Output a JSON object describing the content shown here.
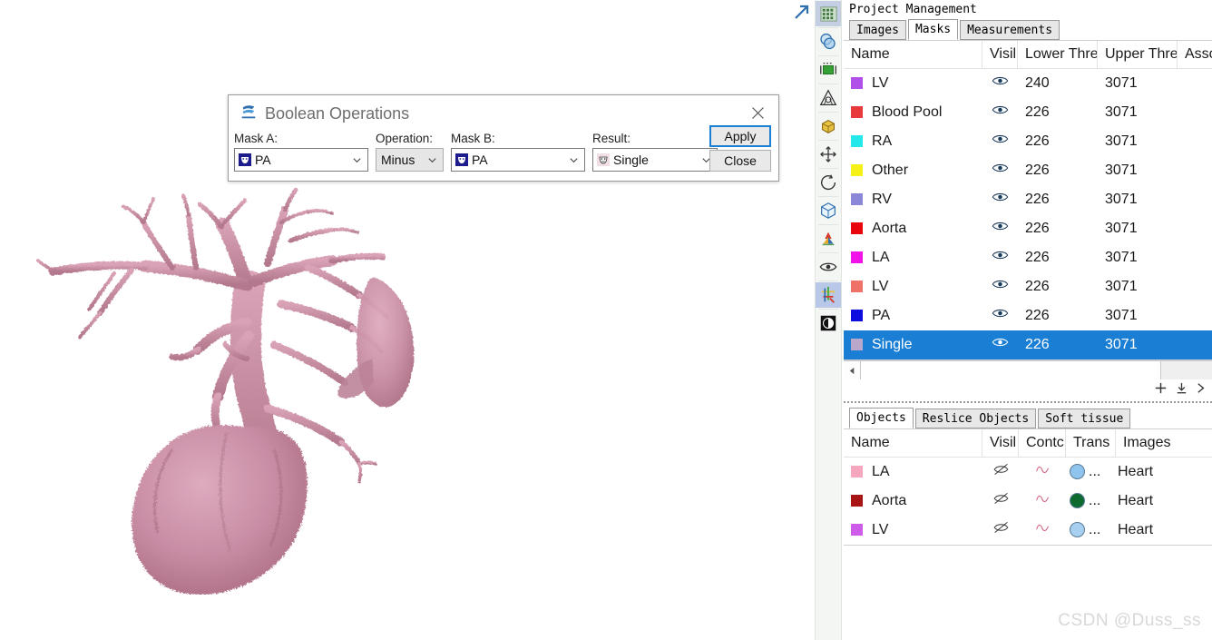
{
  "colors": {
    "accent": "#1a7fd4",
    "panel_bg": "#f4f6f4",
    "heart": "#c78ca2"
  },
  "viewport": {
    "name": "3d-volume-rendering",
    "description": "3D volume rendering of heart and pulmonary vasculature"
  },
  "toolbar": {
    "expand_icon": "expand-arrow-icon",
    "items": [
      {
        "name": "grid-view-icon",
        "label": "Grid View",
        "selected": true
      },
      {
        "name": "boolean-operations-icon",
        "label": "Boolean Operations",
        "selected": false
      },
      {
        "name": "crop-mask-icon",
        "label": "Crop Mask",
        "selected": false
      },
      {
        "name": "region-growing-icon",
        "label": "Region Growing",
        "selected": false
      },
      {
        "name": "calculate-3d-icon",
        "label": "Calculate 3D",
        "selected": false
      },
      {
        "name": "move-icon",
        "label": "Move",
        "selected": false
      },
      {
        "name": "rotate-icon",
        "label": "Rotate",
        "selected": false
      },
      {
        "name": "box-icon",
        "label": "3D Box",
        "selected": false
      },
      {
        "name": "axes-color-icon",
        "label": "Orientation",
        "selected": false
      },
      {
        "name": "eye-icon",
        "label": "Visibility",
        "selected": false
      },
      {
        "name": "axis-cross-icon",
        "label": "Axis Cross",
        "selected": true
      },
      {
        "name": "contrast-icon",
        "label": "Contrast",
        "selected": false
      }
    ]
  },
  "panel": {
    "title": "Project Management",
    "tabs": [
      {
        "label": "Images",
        "active": false
      },
      {
        "label": "Masks",
        "active": true
      },
      {
        "label": "Measurements",
        "active": false
      }
    ],
    "masks_table": {
      "columns": [
        "Name",
        "Visil",
        "Lower Thre",
        "Upper Thre",
        "Asso"
      ],
      "rows": [
        {
          "color": "#b150e8",
          "name": "LV",
          "visible": "eye-icon",
          "lower": "240",
          "upper": "3071",
          "selected": false
        },
        {
          "color": "#e8393c",
          "name": "Blood Pool",
          "visible": "eye-icon",
          "lower": "226",
          "upper": "3071",
          "selected": false
        },
        {
          "color": "#25e8ea",
          "name": "RA",
          "visible": "eye-icon",
          "lower": "226",
          "upper": "3071",
          "selected": false
        },
        {
          "color": "#f5f117",
          "name": "Other",
          "visible": "eye-icon",
          "lower": "226",
          "upper": "3071",
          "selected": false
        },
        {
          "color": "#8a86d8",
          "name": "RV",
          "visible": "eye-icon",
          "lower": "226",
          "upper": "3071",
          "selected": false
        },
        {
          "color": "#e8060c",
          "name": "Aorta",
          "visible": "eye-icon",
          "lower": "226",
          "upper": "3071",
          "selected": false
        },
        {
          "color": "#f012e8",
          "name": "LA",
          "visible": "eye-icon",
          "lower": "226",
          "upper": "3071",
          "selected": false
        },
        {
          "color": "#ef7269",
          "name": "LV",
          "visible": "eye-icon",
          "lower": "226",
          "upper": "3071",
          "selected": false
        },
        {
          "color": "#0d0de0",
          "name": "PA",
          "visible": "eye-icon",
          "lower": "226",
          "upper": "3071",
          "selected": false
        },
        {
          "color": "#b9a8cc",
          "name": "Single",
          "visible": "eye-icon",
          "lower": "226",
          "upper": "3071",
          "selected": true
        }
      ]
    },
    "masks_actions": [
      {
        "name": "add-mask-icon",
        "label": "+"
      },
      {
        "name": "import-mask-icon",
        "label": "import"
      },
      {
        "name": "export-mask-icon",
        "label": "export"
      }
    ],
    "objects_tabs": [
      {
        "label": "Objects",
        "active": true
      },
      {
        "label": "Reslice Objects",
        "active": false
      },
      {
        "label": "Soft tissue",
        "active": false
      }
    ],
    "objects_table": {
      "columns": [
        "Name",
        "Visil",
        "Contc",
        "Trans",
        "Images"
      ],
      "rows": [
        {
          "color": "#f7a7bd",
          "name": "LA",
          "visible": "eye-hidden-icon",
          "contour": "wave-icon",
          "trans_color": "#8fc4ee",
          "trans": "...",
          "images": "Heart"
        },
        {
          "color": "#a81414",
          "name": "Aorta",
          "visible": "eye-hidden-icon",
          "contour": "wave-icon",
          "trans_color": "#0d6b2f",
          "trans": "...",
          "images": "Heart"
        },
        {
          "color": "#cf5ce8",
          "name": "LV",
          "visible": "eye-hidden-icon",
          "contour": "wave-icon",
          "trans_color": "#a7cfef",
          "trans": "...",
          "images": "Heart"
        }
      ]
    }
  },
  "dialog": {
    "title": "Boolean Operations",
    "title_icon": "boolean-operations-icon",
    "close_icon": "close-icon",
    "fields": {
      "mask_a": {
        "label": "Mask A:",
        "value": "PA",
        "icon": "mask-icon-dark"
      },
      "operation": {
        "label": "Operation:",
        "value": "Minus"
      },
      "mask_b": {
        "label": "Mask B:",
        "value": "PA",
        "icon": "mask-icon-dark"
      },
      "result": {
        "label": "Result:",
        "value": "Single",
        "icon": "mask-icon-light"
      }
    },
    "buttons": {
      "apply": "Apply",
      "close": "Close"
    }
  },
  "watermark": {
    "text": "CSDN @Duss_ss"
  }
}
